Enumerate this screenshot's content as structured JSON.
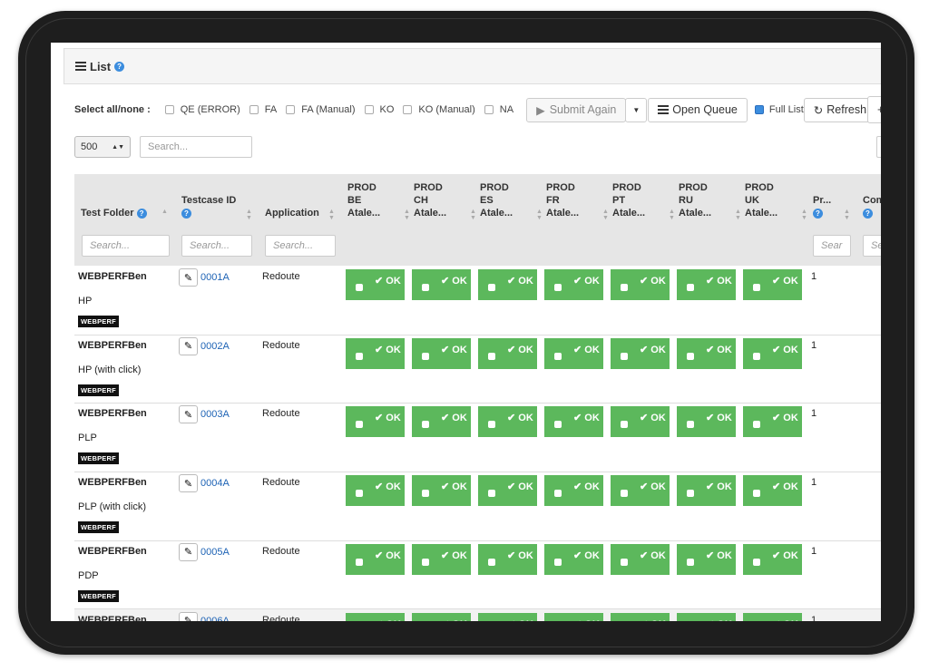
{
  "panel": {
    "title": "List",
    "help": "?"
  },
  "toolbar": {
    "select_label": "Select all/none :",
    "filters": [
      {
        "label": "QE (ERROR)",
        "checked": false
      },
      {
        "label": "FA",
        "checked": false
      },
      {
        "label": "FA (Manual)",
        "checked": false
      },
      {
        "label": "KO",
        "checked": false
      },
      {
        "label": "KO (Manual)",
        "checked": false
      },
      {
        "label": "NA",
        "checked": false
      }
    ],
    "submit_label": "Submit Again",
    "open_queue_label": "Open Queue",
    "full_list_label": "Full List",
    "full_list_checked": true,
    "refresh_label": "Refresh"
  },
  "page_size": {
    "value": "500"
  },
  "search": {
    "placeholder": "Search..."
  },
  "columns": {
    "test_folder": "Test Folder",
    "testcase_id": "Testcase ID",
    "application": "Application",
    "envs": [
      {
        "l1": "PROD",
        "l2": "BE",
        "l3": "Atale..."
      },
      {
        "l1": "PROD",
        "l2": "CH",
        "l3": "Atale..."
      },
      {
        "l1": "PROD",
        "l2": "ES",
        "l3": "Atale..."
      },
      {
        "l1": "PROD",
        "l2": "FR",
        "l3": "Atale..."
      },
      {
        "l1": "PROD",
        "l2": "PT",
        "l3": "Atale..."
      },
      {
        "l1": "PROD",
        "l2": "RU",
        "l3": "Atale..."
      },
      {
        "l1": "PROD",
        "l2": "UK",
        "l3": "Atale..."
      }
    ],
    "priority": "Pr...",
    "comment": "Com"
  },
  "header_search": {
    "main": "Search...",
    "priority": "Sear",
    "comment": "Se"
  },
  "status_label": "OK",
  "colors": {
    "ok": "#5cb85c",
    "link": "#1e63b5",
    "header_bg": "#e6e6e6"
  },
  "rows": [
    {
      "folder": "WEBPERFBen",
      "desc": "HP",
      "badge": "WEBPERF",
      "id": "0001A",
      "app": "Redoute",
      "priority": "1"
    },
    {
      "folder": "WEBPERFBen",
      "desc": "HP (with click)",
      "badge": "WEBPERF",
      "id": "0002A",
      "app": "Redoute",
      "priority": "1"
    },
    {
      "folder": "WEBPERFBen",
      "desc": "PLP",
      "badge": "WEBPERF",
      "id": "0003A",
      "app": "Redoute",
      "priority": "1"
    },
    {
      "folder": "WEBPERFBen",
      "desc": "PLP (with click)",
      "badge": "WEBPERF",
      "id": "0004A",
      "app": "Redoute",
      "priority": "1"
    },
    {
      "folder": "WEBPERFBen",
      "desc": "PDP",
      "badge": "WEBPERF",
      "id": "0005A",
      "app": "Redoute",
      "priority": "1"
    },
    {
      "folder": "WEBPERFBen",
      "desc": "",
      "badge": "",
      "id": "0006A",
      "app": "Redoute",
      "priority": "1"
    }
  ]
}
